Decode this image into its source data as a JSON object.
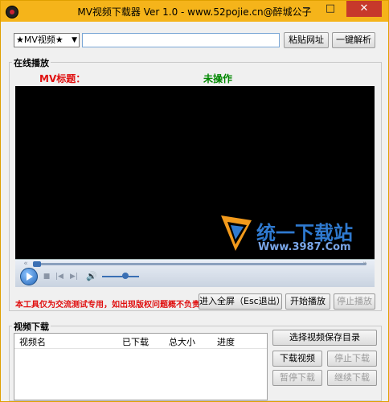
{
  "window": {
    "title": "MV视频下载器 Ver 1.0 - www.52pojie.cn@醉城公子"
  },
  "top": {
    "source_select": "★MV视频★",
    "url_value": "",
    "paste_label": "粘贴网址",
    "parse_label": "一键解析"
  },
  "online": {
    "group_title": "在线播放",
    "mv_title_label": "MV标题：",
    "status": "未操作"
  },
  "watermark": {
    "name": "统一下载站",
    "url": "Www.3987.Com"
  },
  "controls": {
    "disclaimer": "本工具仅为交流测试专用，如出现版权问题概不负责",
    "fullscreen_label": "进入全屏（Esc退出）",
    "start_label": "开始播放",
    "stop_label": "停止播放"
  },
  "download": {
    "group_title": "视频下载",
    "columns": [
      "视频名",
      "已下载",
      "总大小",
      "进度"
    ],
    "choose_dir_label": "选择视频保存目录",
    "download_label": "下载视频",
    "stop_label": "停止下载",
    "pause_label": "暂停下载",
    "resume_label": "继续下载"
  },
  "colors": {
    "titlebar": "#f5b41a",
    "close": "#c7392b",
    "red_text": "#e01010",
    "green_text": "#008800"
  }
}
